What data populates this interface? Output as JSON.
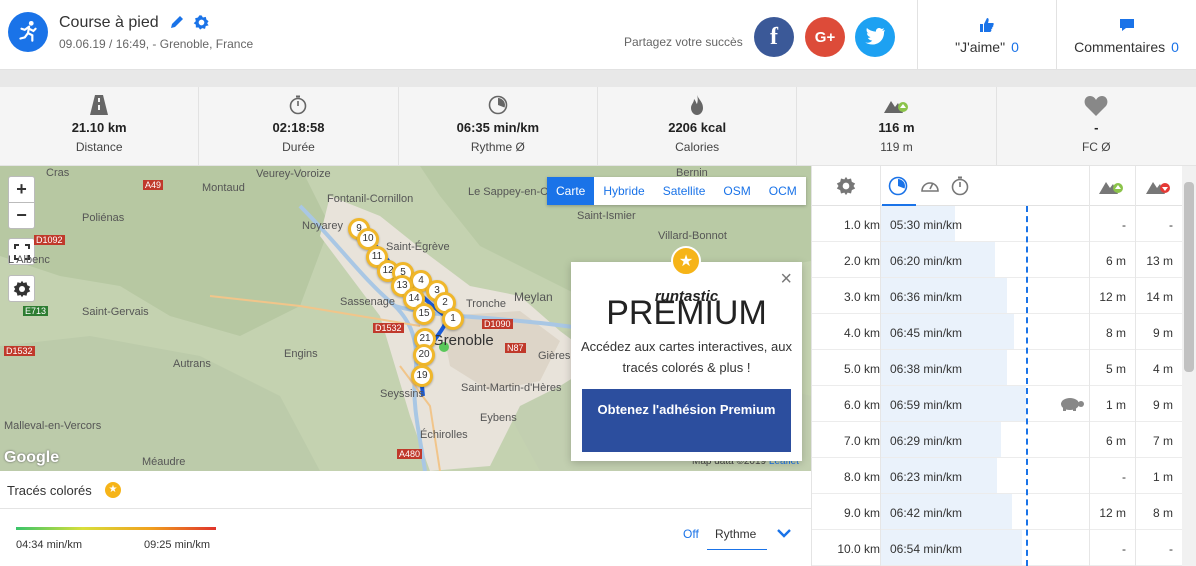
{
  "header": {
    "title": "Course à pied",
    "meta": "09.06.19 / 16:49, - Grenoble, France",
    "share_label": "Partagez votre succès",
    "like_label": "\"J'aime\"",
    "like_count": "0",
    "comments_label": "Commentaires",
    "comments_count": "0"
  },
  "social": {
    "facebook": "f",
    "google": "G+"
  },
  "stats": [
    {
      "icon": "road-icon",
      "value": "21.10 km",
      "label": "Distance"
    },
    {
      "icon": "stopwatch-icon",
      "value": "02:18:58",
      "label": "Durée"
    },
    {
      "icon": "pace-icon",
      "value": "06:35 min/km",
      "label": "Rythme Ø"
    },
    {
      "icon": "flame-icon",
      "value": "2206 kcal",
      "label": "Calories"
    },
    {
      "icon": "elevation-up-icon",
      "value": "116 m",
      "label": "119 m"
    },
    {
      "icon": "heart-icon",
      "value": "-",
      "label": "FC Ø"
    }
  ],
  "map": {
    "zoom_in": "+",
    "zoom_out": "−",
    "tabs": [
      "Carte",
      "Hybride",
      "Satellite",
      "OSM",
      "OCM"
    ],
    "active_tab": "Carte",
    "places": [
      "Cras",
      "Montaud",
      "Veurey-Voroize",
      "Bernin",
      "Fontanil-Cornillon",
      "Le Sappey-en-Chartreuse",
      "Saint-Ismier",
      "Poliénas",
      "Noyarey",
      "Saint-Égrève",
      "Villard-Bonnot",
      "L'Albenc",
      "Sassenage",
      "Tronche",
      "Meylan",
      "Saint-Gervais",
      "Grenoble",
      "Gières",
      "Engins",
      "Autrans",
      "Saint-Martin-d'Hères",
      "Seyssins",
      "Eybens",
      "Malleval-en-Vercors",
      "Échirolles",
      "Méaudre"
    ],
    "roads": [
      "A49",
      "D1092",
      "E713",
      "D1532",
      "D1532",
      "D1090",
      "N87",
      "A480"
    ],
    "markers": [
      "9",
      "10",
      "11",
      "12",
      "5",
      "4",
      "3",
      "13",
      "2",
      "14",
      "15",
      "1",
      "21",
      "20",
      "19"
    ],
    "google": "Google",
    "attribution": "Map data ©2019",
    "leaflet": "Leaflet"
  },
  "premium": {
    "logo": "runtastic",
    "title": "PREMIUM",
    "text": "Accédez aux cartes interactives, aux tracés colorés & plus !",
    "button": "Obtenez l'adhésion Premium",
    "close": "×"
  },
  "traces": {
    "label": "Tracés colorés",
    "min": "04:34 min/km",
    "max": "09:25 min/km",
    "off": "Off",
    "mode": "Rythme"
  },
  "splits": [
    {
      "km": "1.0 km",
      "pace": "05:30 min/km",
      "pace_fraction": 0.36,
      "up": "-",
      "down": "-"
    },
    {
      "km": "2.0 km",
      "pace": "06:20 min/km",
      "pace_fraction": 0.55,
      "up": "6 m",
      "down": "13 m"
    },
    {
      "km": "3.0 km",
      "pace": "06:36 min/km",
      "pace_fraction": 0.61,
      "up": "12 m",
      "down": "14 m"
    },
    {
      "km": "4.0 km",
      "pace": "06:45 min/km",
      "pace_fraction": 0.64,
      "up": "8 m",
      "down": "9 m"
    },
    {
      "km": "5.0 km",
      "pace": "06:38 min/km",
      "pace_fraction": 0.61,
      "up": "5 m",
      "down": "4 m"
    },
    {
      "km": "6.0 km",
      "pace": "06:59 min/km",
      "pace_fraction": 0.7,
      "up": "1 m",
      "down": "9 m",
      "slowest": true
    },
    {
      "km": "7.0 km",
      "pace": "06:29 min/km",
      "pace_fraction": 0.58,
      "up": "6 m",
      "down": "7 m"
    },
    {
      "km": "8.0 km",
      "pace": "06:23 min/km",
      "pace_fraction": 0.56,
      "up": "-",
      "down": "1 m"
    },
    {
      "km": "9.0 km",
      "pace": "06:42 min/km",
      "pace_fraction": 0.63,
      "up": "12 m",
      "down": "8 m"
    },
    {
      "km": "10.0 km",
      "pace": "06:54 min/km",
      "pace_fraction": 0.68,
      "up": "-",
      "down": "-"
    }
  ],
  "colors": {
    "accent": "#1a73e8",
    "premium_button": "#2c4e9e",
    "star": "#f6b418",
    "facebook": "#3b5998",
    "google": "#dd4b39",
    "twitter": "#1da1f2"
  }
}
